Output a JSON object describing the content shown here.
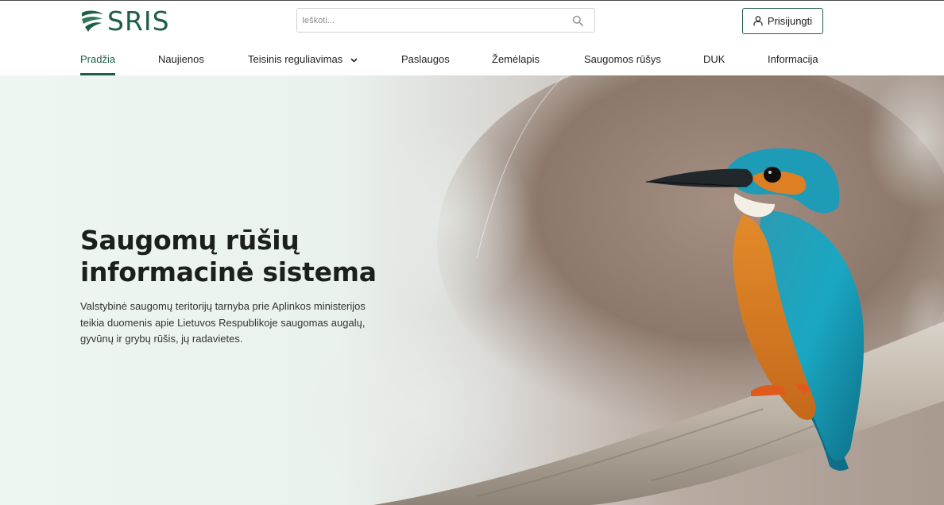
{
  "brand": {
    "logo_text": "SRIS",
    "accent": "#1e5e47"
  },
  "search": {
    "placeholder": "Ieškoti...",
    "value": "",
    "icon": "search-icon"
  },
  "login": {
    "label": "Prisijungti",
    "icon": "user-icon"
  },
  "nav": {
    "items": [
      {
        "label": "Pradžia",
        "active": true
      },
      {
        "label": "Naujienos"
      },
      {
        "label": "Teisinis reguliavimas",
        "has_dropdown": true,
        "icon": "chevron-down-icon"
      },
      {
        "label": "Paslaugos"
      },
      {
        "label": "Žemėlapis"
      },
      {
        "label": "Saugomos rūšys"
      },
      {
        "label": "DUK"
      },
      {
        "label": "Informacija"
      }
    ]
  },
  "hero": {
    "title_line1": "Saugomų rūšių",
    "title_line2": "informacinė sistema",
    "description": "Valstybinė saugomų teritorijų tarnyba prie Aplinkos ministerijos teikia duomenis apie Lietuvos Respublikoje saugomas augalų, gyvūnų ir grybų rūšis, jų radavietes.",
    "image": "kingfisher-on-branch"
  }
}
